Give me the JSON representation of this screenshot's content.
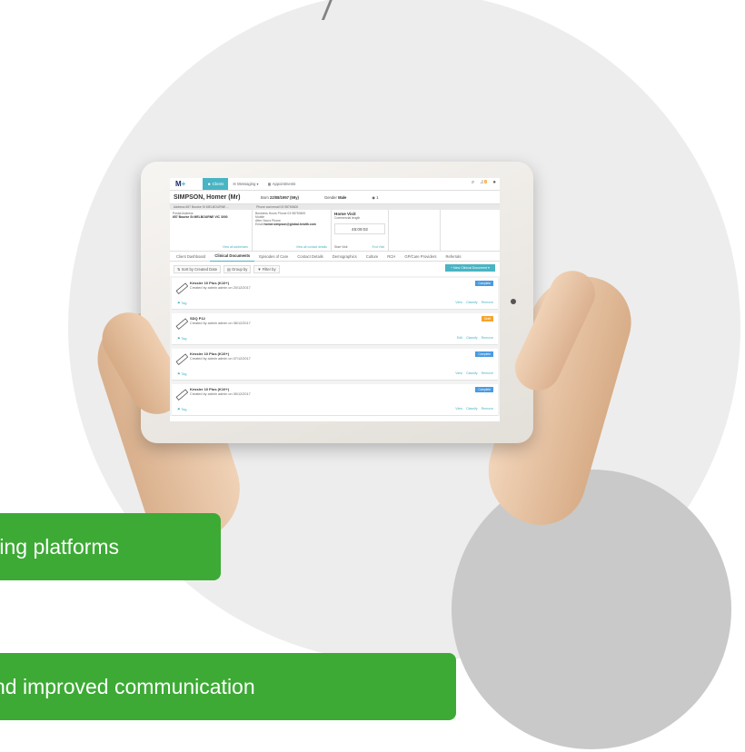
{
  "app": {
    "logo": "M",
    "logo_plus": "+"
  },
  "nav": {
    "tabs": [
      {
        "label": "Clients",
        "icon": "users-icon",
        "active": true
      },
      {
        "label": "Messaging ▾",
        "icon": "envelope-icon",
        "active": false
      },
      {
        "label": "Appointments",
        "icon": "calendar-icon",
        "active": false
      }
    ],
    "search_icon": "⌕",
    "bell_icon": "🔔",
    "notification_count": "3",
    "user_icon": "👤"
  },
  "client": {
    "name": "SIMPSON, Homer (Mr)",
    "born_label": "Born",
    "born_value": "22/08/1957 (59y)",
    "gender_label": "Gender",
    "gender_value": "Male",
    "id_value": "1"
  },
  "info_bar": {
    "address": "Address 657 Bourke St MELBOURNE ...",
    "phone": "Phone and email 03 98750600"
  },
  "panels": {
    "postal_label": "Postal Address",
    "postal_value": "657 Bourke St MELBOURNE VIC 3000",
    "all_addresses": "View all addresses",
    "business_phone": "Business Hours Phone 03 98750600",
    "mobile": "Mobile",
    "after_hours": "After Hours Phone",
    "email_label": "Email",
    "email_value": "homer.simpson@global-health.com",
    "all_contacts": "View all contact details",
    "home_visit_title": "Home Visit",
    "home_visit_sub": "Commercial length",
    "home_visit_value": "45:09:02",
    "start_visit": "Start Visit",
    "end_visit": "End Visit"
  },
  "tabs": [
    "Client Dashboard",
    "Clinical Documents",
    "Episodes of Care",
    "Contact Details",
    "Demographics",
    "Culture",
    "RCH",
    "GP/Care Providers",
    "Referrals"
  ],
  "toolbar": {
    "sort_label": "Sort by Created Date",
    "group_label": "Group by",
    "filter_label": "Filter by",
    "new_doc_label": "+ New Clinical Document ▾"
  },
  "documents": [
    {
      "title": "Kessler 10 Plus (K10+)",
      "meta": "Created by admin admin on 20/12/2017",
      "status": "Complete",
      "status_type": "complete",
      "actions": [
        "View",
        "Classify",
        "Remove"
      ]
    },
    {
      "title": "SDQ P12",
      "meta": "Created by admin admin on 08/12/2017",
      "status": "Draft",
      "status_type": "draft",
      "actions": [
        "Edit",
        "Classify",
        "Remove"
      ]
    },
    {
      "title": "Kessler 10 Plus (K10+)",
      "meta": "Created by admin admin on 07/12/2017",
      "status": "Complete",
      "status_type": "complete",
      "actions": [
        "View",
        "Classify",
        "Remove"
      ]
    },
    {
      "title": "Kessler 10 Plus (K10+)",
      "meta": "Created by admin admin on 05/12/2017",
      "status": "Complete",
      "status_type": "complete",
      "actions": [
        "View",
        "Classify",
        "Remove"
      ]
    }
  ],
  "tag_label": "Tag",
  "banners": {
    "first": "ting platforms",
    "second": "nd improved communication"
  },
  "colors": {
    "accent": "#49b4c3",
    "green": "#3daa35",
    "draft": "#f7a42c",
    "complete": "#4a9be0"
  }
}
